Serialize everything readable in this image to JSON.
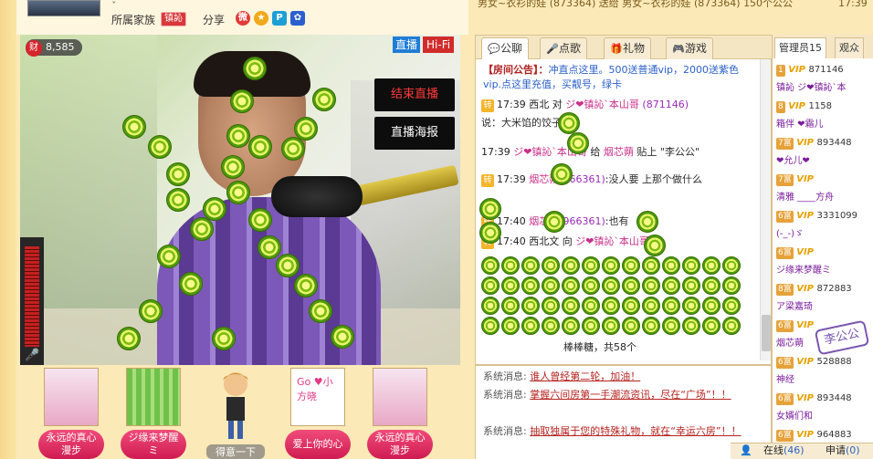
{
  "header": {
    "top_name_fragment": "ˇ",
    "family_label": "所属家族",
    "family_badge": "镇訫",
    "share_label": "分享",
    "share_icons": [
      "weibo-icon",
      "star-icon",
      "p-icon",
      "paw-icon"
    ]
  },
  "video": {
    "coin_count": "8,585",
    "coin_icon_label": "财",
    "live_label": "直播",
    "hifi_label": "Hi-Fi",
    "end_live_label": "结束直播",
    "poster_label": "直播海报",
    "volume_icon": "microphone-icon"
  },
  "gifts": [
    {
      "label": "永远的真心\n漫步"
    },
    {
      "label": "ジ缘来梦醒\nミ"
    },
    {
      "label": "得意一下"
    },
    {
      "label": "爱上你的心"
    },
    {
      "label": "永远的真心\n漫步"
    }
  ],
  "gift_card_text": "Go ♥小方晓",
  "top_marquee": "男女~衣衫的娃 (873364) 送给 男女~衣衫的娃 (873364) 150个公公",
  "top_time": "17:39",
  "chat": {
    "tabs": [
      {
        "icon": "chat-icon",
        "label": "公聊"
      },
      {
        "icon": "mic-icon",
        "label": "点歌"
      },
      {
        "icon": "gift-icon",
        "label": "礼物"
      },
      {
        "icon": "gamepad-icon",
        "label": "游戏"
      }
    ],
    "notice_head": "【房间公告】：",
    "notice_text": "冲直点这里。500送普通vip，2000送紫色vip.点这里充值，买靓号，绿卡",
    "messages": [
      {
        "time": "17:39",
        "name": "西北",
        "mid": "对",
        "target": "ジ❤镇訫`本山哥",
        "tid": "(871146)"
      },
      {
        "time": "",
        "name": "",
        "mid": "",
        "target": "",
        "tid": "",
        "text": "说：大米馅的饺子吧"
      },
      {
        "time": "17:39",
        "name": "ジ❤镇訫`本山哥",
        "mid": "给",
        "target": "烟芯蒴",
        "tid": "",
        "text": "贴上 \"李公公\""
      },
      {
        "time": "17:39",
        "name": "烟芯蒴",
        "mid": "",
        "target": "",
        "tid": "(966361)",
        "text": ":没人要 上那个做什么"
      },
      {
        "time": "17:40",
        "name": "烟芯蒴",
        "mid": "",
        "target": "",
        "tid": "(966361)",
        "text": ":也有"
      },
      {
        "time": "17:40",
        "name": "西北文",
        "mid": "向",
        "target": "ジ❤镇訫`本山哥",
        "tid": "",
        "text": "送"
      }
    ],
    "gift_summary": "棒棒糖，共58个",
    "system_label": "系统消息:",
    "system_messages": [
      "谁人曾经第二轮，加油！",
      "掌握六间房第一手潮流资讯，尽在“广场”！！",
      "抽取独属于您的特殊礼物，就在“幸运六房”！！"
    ]
  },
  "users": {
    "tabs": [
      "管理员15",
      "观众"
    ],
    "rows": [
      {
        "lvl": "1",
        "vip": "VIP",
        "num": "871146",
        "name": ""
      },
      {
        "lvl": "",
        "vip": "",
        "num": "",
        "name": "镇訫 ジ❤镇訫`本"
      },
      {
        "lvl": "8",
        "vip": "VIP",
        "num": "1158",
        "name": ""
      },
      {
        "lvl": "",
        "vip": "",
        "num": "",
        "name": "箱伴 ❤霜儿"
      },
      {
        "lvl": "7富",
        "vip": "VIP",
        "num": "893448",
        "name": ""
      },
      {
        "lvl": "",
        "vip": "",
        "num": "",
        "name": "❤允儿❤"
      },
      {
        "lvl": "7富",
        "vip": "VIP",
        "num": "",
        "name": ""
      },
      {
        "lvl": "",
        "vip": "",
        "num": "",
        "name": "清雅 ____方舟"
      },
      {
        "lvl": "6富",
        "vip": "VIP",
        "num": "3331099",
        "name": ""
      },
      {
        "lvl": "",
        "vip": "",
        "num": "",
        "name": "(-_-)ゞ"
      },
      {
        "lvl": "6富",
        "vip": "VIP",
        "num": "",
        "name": ""
      },
      {
        "lvl": "",
        "vip": "",
        "num": "",
        "name": "ジ缘来梦醒ミ"
      },
      {
        "lvl": "8富",
        "vip": "VIP",
        "num": "872883",
        "name": ""
      },
      {
        "lvl": "",
        "vip": "",
        "num": "",
        "name": "ア梁嘉琦"
      },
      {
        "lvl": "6富",
        "vip": "VIP",
        "num": "",
        "name": ""
      },
      {
        "lvl": "",
        "vip": "",
        "num": "",
        "name": "烟芯蒴"
      },
      {
        "lvl": "6富",
        "vip": "VIP",
        "num": "528888",
        "name": ""
      },
      {
        "lvl": "",
        "vip": "",
        "num": "",
        "name": "神经"
      },
      {
        "lvl": "6富",
        "vip": "VIP",
        "num": "893448",
        "name": ""
      },
      {
        "lvl": "",
        "vip": "",
        "num": "",
        "name": "女婿们和"
      },
      {
        "lvl": "6富",
        "vip": "VIP",
        "num": "964883",
        "name": ""
      }
    ],
    "stamp_text": "李公公"
  },
  "bottom": {
    "online_label": "在线",
    "online_count": "(46)",
    "apply_label": "申请",
    "apply_count": "(0)"
  },
  "colors": {
    "accent": "#d22b2b",
    "panel_bg": "#fbe9b7",
    "live_blue": "#1f7dd5"
  }
}
